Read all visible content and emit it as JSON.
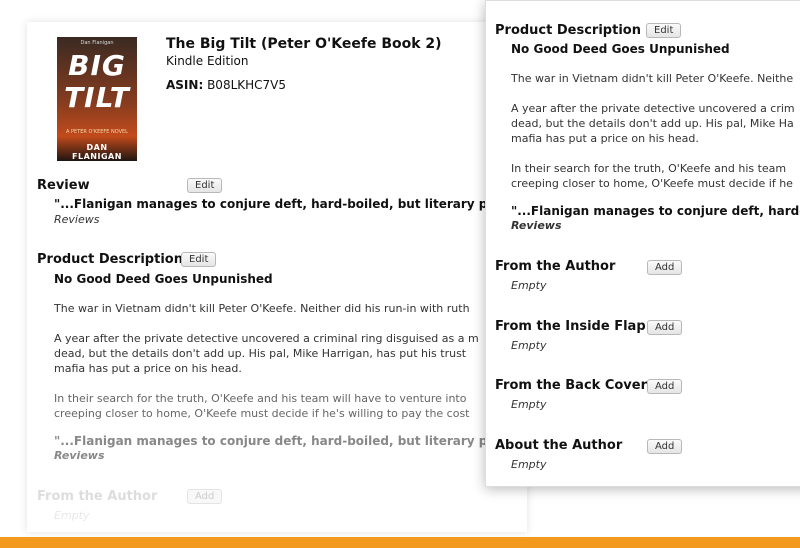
{
  "book": {
    "title": "The Big Tilt (Peter O'Keefe Book 2)",
    "edition": "Kindle Edition",
    "asin_label": "ASIN:",
    "asin": "B08LKHC7V5",
    "cover_top_text": "Dan Flanigan",
    "cover_word1": "BIG",
    "cover_word2": "TILT",
    "cover_series": "A PETER O'KEEFE NOVEL",
    "cover_author": "DAN FLANIGAN"
  },
  "buttons": {
    "edit": "Edit",
    "add": "Add"
  },
  "sections": {
    "review": "Review",
    "product_description": "Product Description",
    "from_author": "From the Author",
    "inside_flap": "From the Inside Flap",
    "back_cover": "From the Back Cover",
    "about_author": "About the Author"
  },
  "review": {
    "quote": "\"...Flanigan manages to conjure deft, hard-boiled, but literary prose",
    "source": "Reviews"
  },
  "description": {
    "headline": "No Good Deed Goes Unpunished",
    "p1": "The war in Vietnam didn't kill Peter O'Keefe. Neither did his run-in with ruth",
    "p2_l1": "A year after the private detective uncovered a criminal ring disguised as a m",
    "p2_l2": "dead, but the details don't add up. His pal, Mike Harrigan, has put his trust",
    "p2_l3": "mafia has put a price on his head.",
    "p3_l1": "In their search for the truth, O'Keefe and his team will have to venture into",
    "p3_l2": "creeping closer to home, O'Keefe must decide if he's willing to pay the cost",
    "quote": "\"...Flanigan manages to conjure deft, hard-boiled, but literary prose",
    "source": "Reviews"
  },
  "front": {
    "p1": "The war in Vietnam didn't kill Peter O'Keefe. Neithe",
    "p2_l1": "A year after the private detective uncovered a crim",
    "p2_l2": "dead, but the details don't add up. His pal, Mike Ha",
    "p2_l3": "mafia has put a price on his head.",
    "p3_l1": "In their search for the truth, O'Keefe and his team",
    "p3_l2": "creeping closer to home, O'Keefe must decide if he",
    "quote": "\"...Flanigan manages to conjure deft, hard-bo",
    "source": "Reviews"
  },
  "empty_text": "Empty",
  "colors": {
    "accent_bar": "#f39a1e"
  }
}
